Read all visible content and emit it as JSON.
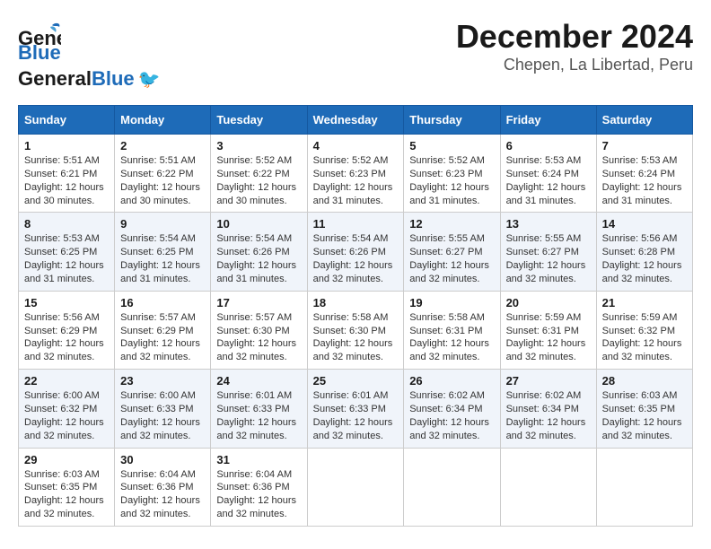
{
  "header": {
    "logo_general": "General",
    "logo_blue": "Blue",
    "month": "December 2024",
    "location": "Chepen, La Libertad, Peru"
  },
  "weekdays": [
    "Sunday",
    "Monday",
    "Tuesday",
    "Wednesday",
    "Thursday",
    "Friday",
    "Saturday"
  ],
  "weeks": [
    [
      {
        "day": "1",
        "sunrise": "5:51 AM",
        "sunset": "6:21 PM",
        "daylight": "12 hours and 30 minutes."
      },
      {
        "day": "2",
        "sunrise": "5:51 AM",
        "sunset": "6:22 PM",
        "daylight": "12 hours and 30 minutes."
      },
      {
        "day": "3",
        "sunrise": "5:52 AM",
        "sunset": "6:22 PM",
        "daylight": "12 hours and 30 minutes."
      },
      {
        "day": "4",
        "sunrise": "5:52 AM",
        "sunset": "6:23 PM",
        "daylight": "12 hours and 31 minutes."
      },
      {
        "day": "5",
        "sunrise": "5:52 AM",
        "sunset": "6:23 PM",
        "daylight": "12 hours and 31 minutes."
      },
      {
        "day": "6",
        "sunrise": "5:53 AM",
        "sunset": "6:24 PM",
        "daylight": "12 hours and 31 minutes."
      },
      {
        "day": "7",
        "sunrise": "5:53 AM",
        "sunset": "6:24 PM",
        "daylight": "12 hours and 31 minutes."
      }
    ],
    [
      {
        "day": "8",
        "sunrise": "5:53 AM",
        "sunset": "6:25 PM",
        "daylight": "12 hours and 31 minutes."
      },
      {
        "day": "9",
        "sunrise": "5:54 AM",
        "sunset": "6:25 PM",
        "daylight": "12 hours and 31 minutes."
      },
      {
        "day": "10",
        "sunrise": "5:54 AM",
        "sunset": "6:26 PM",
        "daylight": "12 hours and 31 minutes."
      },
      {
        "day": "11",
        "sunrise": "5:54 AM",
        "sunset": "6:26 PM",
        "daylight": "12 hours and 32 minutes."
      },
      {
        "day": "12",
        "sunrise": "5:55 AM",
        "sunset": "6:27 PM",
        "daylight": "12 hours and 32 minutes."
      },
      {
        "day": "13",
        "sunrise": "5:55 AM",
        "sunset": "6:27 PM",
        "daylight": "12 hours and 32 minutes."
      },
      {
        "day": "14",
        "sunrise": "5:56 AM",
        "sunset": "6:28 PM",
        "daylight": "12 hours and 32 minutes."
      }
    ],
    [
      {
        "day": "15",
        "sunrise": "5:56 AM",
        "sunset": "6:29 PM",
        "daylight": "12 hours and 32 minutes."
      },
      {
        "day": "16",
        "sunrise": "5:57 AM",
        "sunset": "6:29 PM",
        "daylight": "12 hours and 32 minutes."
      },
      {
        "day": "17",
        "sunrise": "5:57 AM",
        "sunset": "6:30 PM",
        "daylight": "12 hours and 32 minutes."
      },
      {
        "day": "18",
        "sunrise": "5:58 AM",
        "sunset": "6:30 PM",
        "daylight": "12 hours and 32 minutes."
      },
      {
        "day": "19",
        "sunrise": "5:58 AM",
        "sunset": "6:31 PM",
        "daylight": "12 hours and 32 minutes."
      },
      {
        "day": "20",
        "sunrise": "5:59 AM",
        "sunset": "6:31 PM",
        "daylight": "12 hours and 32 minutes."
      },
      {
        "day": "21",
        "sunrise": "5:59 AM",
        "sunset": "6:32 PM",
        "daylight": "12 hours and 32 minutes."
      }
    ],
    [
      {
        "day": "22",
        "sunrise": "6:00 AM",
        "sunset": "6:32 PM",
        "daylight": "12 hours and 32 minutes."
      },
      {
        "day": "23",
        "sunrise": "6:00 AM",
        "sunset": "6:33 PM",
        "daylight": "12 hours and 32 minutes."
      },
      {
        "day": "24",
        "sunrise": "6:01 AM",
        "sunset": "6:33 PM",
        "daylight": "12 hours and 32 minutes."
      },
      {
        "day": "25",
        "sunrise": "6:01 AM",
        "sunset": "6:33 PM",
        "daylight": "12 hours and 32 minutes."
      },
      {
        "day": "26",
        "sunrise": "6:02 AM",
        "sunset": "6:34 PM",
        "daylight": "12 hours and 32 minutes."
      },
      {
        "day": "27",
        "sunrise": "6:02 AM",
        "sunset": "6:34 PM",
        "daylight": "12 hours and 32 minutes."
      },
      {
        "day": "28",
        "sunrise": "6:03 AM",
        "sunset": "6:35 PM",
        "daylight": "12 hours and 32 minutes."
      }
    ],
    [
      {
        "day": "29",
        "sunrise": "6:03 AM",
        "sunset": "6:35 PM",
        "daylight": "12 hours and 32 minutes."
      },
      {
        "day": "30",
        "sunrise": "6:04 AM",
        "sunset": "6:36 PM",
        "daylight": "12 hours and 32 minutes."
      },
      {
        "day": "31",
        "sunrise": "6:04 AM",
        "sunset": "6:36 PM",
        "daylight": "12 hours and 32 minutes."
      },
      null,
      null,
      null,
      null
    ]
  ]
}
